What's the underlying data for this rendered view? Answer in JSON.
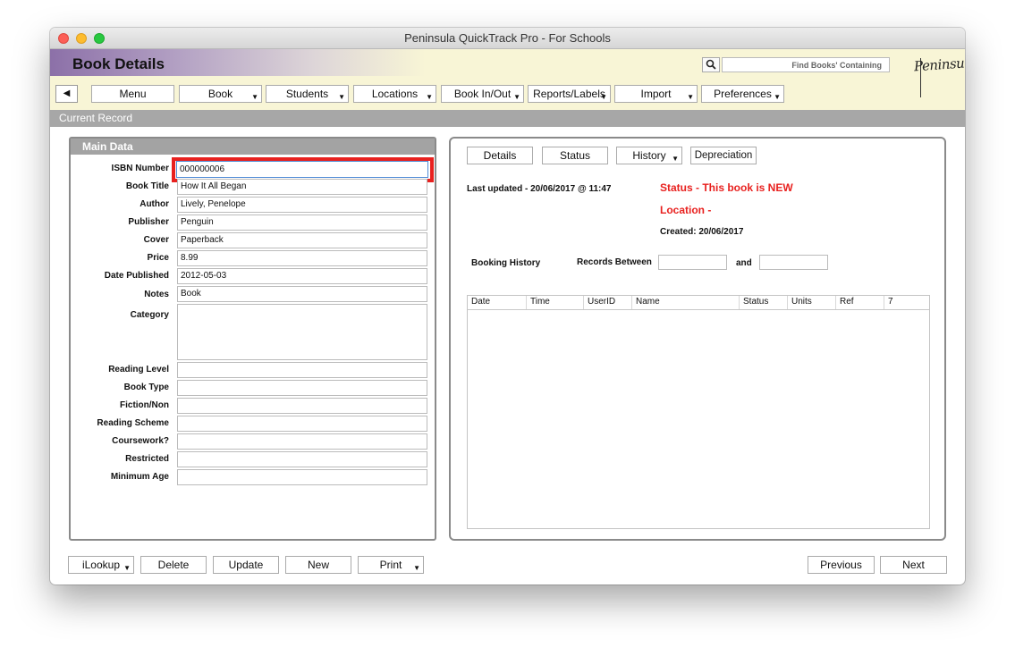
{
  "window": {
    "title": "Peninsula QuickTrack Pro - For Schools"
  },
  "header": {
    "page_title": "Book Details",
    "search_placeholder": "Find Books' Containing",
    "logo_text": "Peninsula",
    "accent_color": "#8c70a8",
    "background_color": "#f8f5d6"
  },
  "nav": {
    "back_icon": "triangle-left",
    "items": [
      {
        "label": "Menu",
        "dropdown": false
      },
      {
        "label": "Book",
        "dropdown": true
      },
      {
        "label": "Students",
        "dropdown": true
      },
      {
        "label": "Locations",
        "dropdown": true
      },
      {
        "label": "Book In/Out",
        "dropdown": true
      },
      {
        "label": "Reports/Labels",
        "dropdown": true
      },
      {
        "label": "Import",
        "dropdown": true
      },
      {
        "label": "Preferences",
        "dropdown": true
      }
    ]
  },
  "record_bar": {
    "label": "Current Record"
  },
  "main_data": {
    "title": "Main Data",
    "fields": [
      {
        "label": "ISBN Number",
        "value": "000000006"
      },
      {
        "label": "Book Title",
        "value": "How It All Began"
      },
      {
        "label": "Author",
        "value": "Lively, Penelope"
      },
      {
        "label": "Publisher",
        "value": "Penguin"
      },
      {
        "label": "Cover",
        "value": "Paperback"
      },
      {
        "label": "Price",
        "value": "8.99"
      },
      {
        "label": "Date Published",
        "value": "2012-05-03"
      },
      {
        "label": "Notes",
        "value": "Book"
      },
      {
        "label": "Category",
        "value": ""
      },
      {
        "label": "Reading Level",
        "value": ""
      },
      {
        "label": "Book Type",
        "value": ""
      },
      {
        "label": "Fiction/Non",
        "value": ""
      },
      {
        "label": "Reading Scheme",
        "value": ""
      },
      {
        "label": "Coursework?",
        "value": ""
      },
      {
        "label": "Restricted",
        "value": ""
      },
      {
        "label": "Minimum Age",
        "value": ""
      }
    ]
  },
  "detail_tabs": [
    {
      "label": "Details",
      "dropdown": false
    },
    {
      "label": "Status",
      "dropdown": false
    },
    {
      "label": "History",
      "dropdown": true
    },
    {
      "label": "Depreciation",
      "dropdown": false
    }
  ],
  "status": {
    "last_updated": "Last updated - 20/06/2017 @ 11:47",
    "status_text": "Status - This book is NEW",
    "location_text": "Location -",
    "created": "Created: 20/06/2017",
    "status_color": "#e8211f"
  },
  "booking": {
    "title": "Booking History",
    "records_between": "Records Between",
    "and_label": "and",
    "from_value": "",
    "to_value": "",
    "columns": [
      "Date",
      "Time",
      "UserID",
      "Name",
      "Status",
      "Units",
      "Ref",
      "7"
    ],
    "rows": []
  },
  "footer": {
    "buttons": [
      {
        "label": "iLookup",
        "dropdown": true
      },
      {
        "label": "Delete",
        "dropdown": false
      },
      {
        "label": "Update",
        "dropdown": false
      },
      {
        "label": "New",
        "dropdown": false
      },
      {
        "label": "Print",
        "dropdown": true
      }
    ],
    "previous_label": "Previous",
    "next_label": "Next"
  }
}
